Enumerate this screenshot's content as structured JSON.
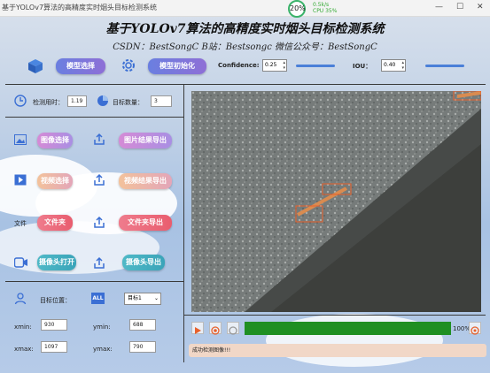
{
  "window": {
    "title": "基于YOLOv7算法的高精度实时烟头目标检测系统"
  },
  "hud": {
    "percent": "20%",
    "net": "0.5k/s",
    "cpu": "CPU 35%"
  },
  "header": {
    "title": "基于YOLOv7算法的高精度实时烟头目标检测系统",
    "subtitle": "CSDN：BestSongC  B站：Bestsongc  微信公众号：BestSongC"
  },
  "toolbar": {
    "model_select": "模型选择",
    "model_init": "模型初始化",
    "confidence_label": "Confidence:",
    "confidence_value": "0.25",
    "iou_label": "IOU：",
    "iou_value": "0.40"
  },
  "stats": {
    "time_label": "检测用时：",
    "time_value": "1.19",
    "count_label": "目标数量：",
    "count_value": "3"
  },
  "image_row": {
    "select": "图像选择",
    "export": "图片结果导出"
  },
  "video_row": {
    "select": "视频选择",
    "export": "视频结果导出"
  },
  "folder_row": {
    "label": "文件",
    "select": "文件夹",
    "export": "文件夹导出"
  },
  "camera_row": {
    "open": "摄像头打开",
    "export": "摄像头导出"
  },
  "target": {
    "label": "目标位置：",
    "all_badge": "ALL",
    "selected": "目标1",
    "xmin_label": "xmin:",
    "xmin": "930",
    "ymin_label": "ymin:",
    "ymin": "688",
    "xmax_label": "xmax:",
    "xmax": "1097",
    "ymax_label": "ymax:",
    "ymax": "790"
  },
  "player": {
    "progress": 1.0,
    "progress_label": "100%"
  },
  "status": {
    "message": "成功检测图像!!!"
  },
  "colors": {
    "progress": "#1f8f22",
    "accent": "#3b6fd4"
  }
}
